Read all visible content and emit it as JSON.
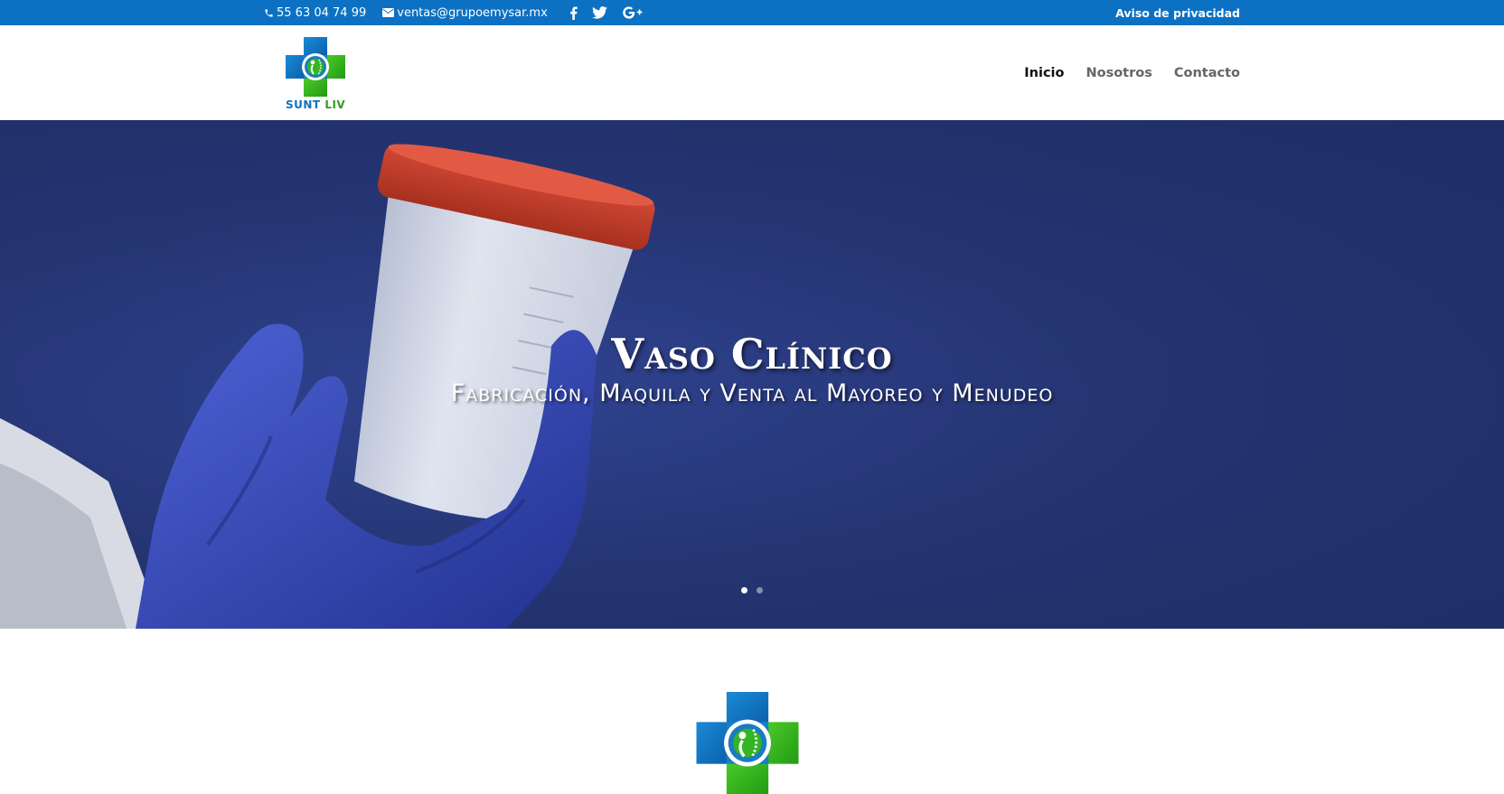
{
  "topbar": {
    "phone": "55 63 04 74 99",
    "email": "ventas@grupoemysar.mx",
    "social": [
      "facebook-icon",
      "twitter-icon",
      "google-plus-icon"
    ],
    "privacy_link": "Aviso de privacidad"
  },
  "header": {
    "logo_text_part1": "SUNT",
    "logo_text_part2": "LIV",
    "nav": [
      {
        "label": "Inicio",
        "active": true
      },
      {
        "label": "Nosotros",
        "active": false
      },
      {
        "label": "Contacto",
        "active": false
      }
    ]
  },
  "hero": {
    "title": "Vaso Clínico",
    "subtitle": "Fabricación, Maquila y Venta al Mayoreo y Menudeo",
    "slides_total": 2,
    "active_slide": 1
  },
  "colors": {
    "topbar": "#0c71c3",
    "hero_bg": "#24336f",
    "logo_blue": "#0c71c3",
    "logo_green": "#2ca01c"
  }
}
